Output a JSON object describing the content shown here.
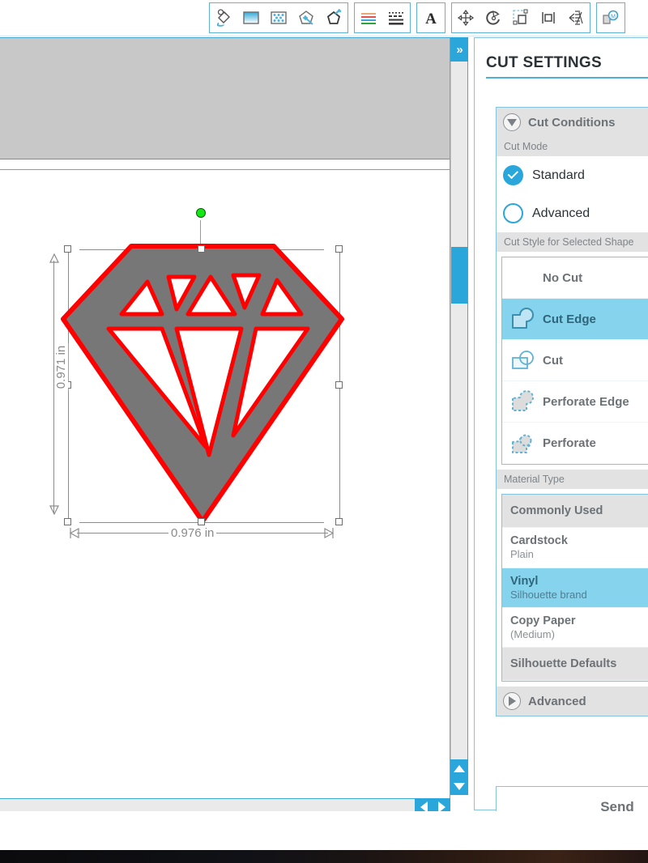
{
  "toolbar": {
    "groups": [
      {
        "name": "fill-tools",
        "buttons": [
          {
            "icon": "fill-color-icon",
            "label": "Fill Color"
          },
          {
            "icon": "fill-gradient-icon",
            "label": "Gradient Fill"
          },
          {
            "icon": "fill-pattern-icon",
            "label": "Pattern Fill"
          },
          {
            "icon": "line-color-icon",
            "label": "Line Color"
          },
          {
            "icon": "line-style-icon",
            "label": "Line Style"
          }
        ]
      },
      {
        "name": "stroke-tools",
        "buttons": [
          {
            "icon": "sketch-pen-lines-icon",
            "label": "Sketch Pen Colors"
          },
          {
            "icon": "dashed-lines-icon",
            "label": "Line Styles"
          }
        ]
      },
      {
        "name": "text-tools",
        "buttons": [
          {
            "icon": "text-style-icon",
            "label": "Text Style"
          }
        ]
      },
      {
        "name": "transform-tools",
        "buttons": [
          {
            "icon": "move-arrows-icon",
            "label": "Transform"
          },
          {
            "icon": "rotate-icon",
            "label": "Rotate"
          },
          {
            "icon": "scale-icon",
            "label": "Scale"
          },
          {
            "icon": "align-icon",
            "label": "Align"
          },
          {
            "icon": "replicate-icon",
            "label": "Replicate"
          }
        ]
      },
      {
        "name": "modify-tools",
        "buttons": [
          {
            "icon": "modify-merge-icon",
            "label": "Modify"
          }
        ]
      }
    ]
  },
  "canvas": {
    "selection": {
      "height_label": "0.971 in",
      "width_label": "0.976 in",
      "shape_name": "diamond-shape",
      "fill_color": "#777777",
      "cut_line_color": "#ff0000",
      "rotation_handle_color": "#14e814"
    },
    "scrollbars": {
      "collapse_label": "»",
      "v_up": "▲",
      "v_down": "▼",
      "h_left": "◀",
      "h_right": "▶"
    }
  },
  "panel": {
    "title": "CUT SETTINGS",
    "cut_conditions": {
      "header": "Cut Conditions",
      "expanded": true,
      "cut_mode": {
        "label": "Cut Mode",
        "options": [
          {
            "label": "Standard",
            "selected": true
          },
          {
            "label": "Advanced",
            "selected": false
          }
        ]
      },
      "cut_style": {
        "label": "Cut Style for Selected Shape",
        "options": [
          {
            "label": "No Cut",
            "icon": "none",
            "selected": false
          },
          {
            "label": "Cut Edge",
            "icon": "cut-edge-icon",
            "selected": true
          },
          {
            "label": "Cut",
            "icon": "cut-icon",
            "selected": false
          },
          {
            "label": "Perforate Edge",
            "icon": "perforate-edge-icon",
            "selected": false
          },
          {
            "label": "Perforate",
            "icon": "perforate-icon",
            "selected": false
          }
        ]
      },
      "material_type": {
        "label": "Material Type",
        "options": [
          {
            "name": "Commonly Used",
            "sub": "",
            "group": true,
            "selected": false
          },
          {
            "name": "Cardstock",
            "sub": "Plain",
            "group": false,
            "selected": false
          },
          {
            "name": "Vinyl",
            "sub": "Silhouette brand",
            "group": false,
            "selected": true
          },
          {
            "name": "Copy Paper",
            "sub": "(Medium)",
            "group": false,
            "selected": false
          },
          {
            "name": "Silhouette Defaults",
            "sub": "",
            "group": true,
            "selected": false
          }
        ]
      }
    },
    "advanced": {
      "header": "Advanced",
      "expanded": false
    },
    "send_button": {
      "label": "Send"
    },
    "accent_color": "#2ba6db",
    "selection_color": "#86d3ee"
  }
}
